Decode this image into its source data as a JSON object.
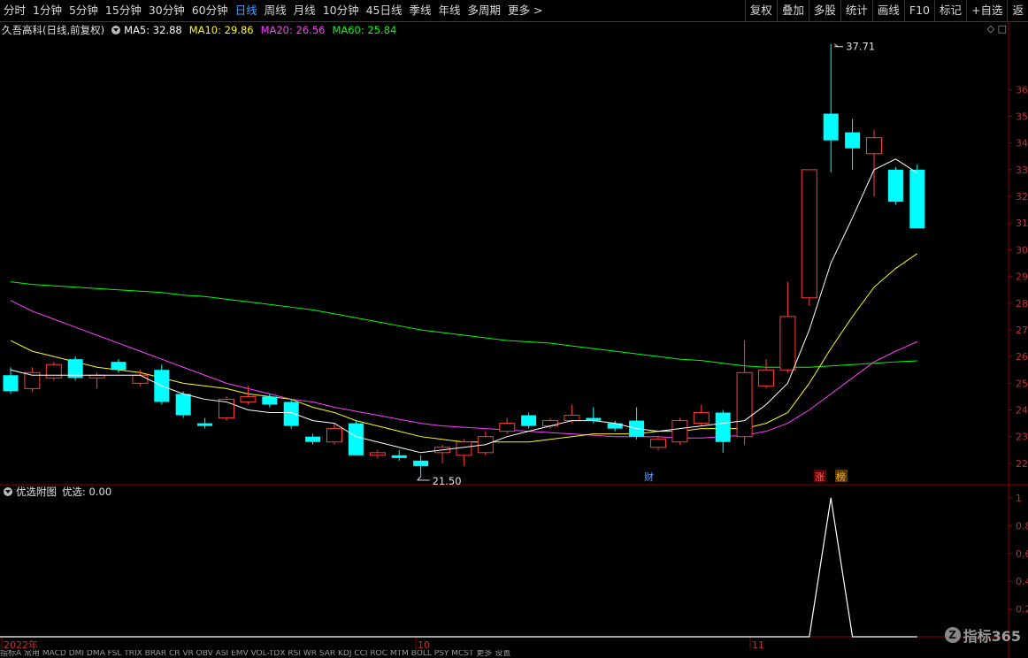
{
  "toolbar": {
    "left_items": [
      {
        "label": "分时",
        "active": false
      },
      {
        "label": "1分钟",
        "active": false
      },
      {
        "label": "5分钟",
        "active": false
      },
      {
        "label": "15分钟",
        "active": false
      },
      {
        "label": "30分钟",
        "active": false
      },
      {
        "label": "60分钟",
        "active": false
      },
      {
        "label": "日线",
        "active": true
      },
      {
        "label": "周线",
        "active": false
      },
      {
        "label": "月线",
        "active": false
      },
      {
        "label": "10分钟",
        "active": false
      },
      {
        "label": "45日线",
        "active": false
      },
      {
        "label": "季线",
        "active": false
      },
      {
        "label": "年线",
        "active": false
      },
      {
        "label": "多周期",
        "active": false
      },
      {
        "label": "更多 >",
        "active": false
      }
    ],
    "right_items": [
      "复权",
      "叠加",
      "多股",
      "统计",
      "画线",
      "F10",
      "标记",
      "+自选",
      "返"
    ]
  },
  "stock": {
    "title": "久吾高科(日线,前复权)"
  },
  "ma_legend": [
    {
      "label": "MA5: 32.88",
      "color": "#ffffff"
    },
    {
      "label": "MA10: 29.86",
      "color": "#ffff00"
    },
    {
      "label": "MA20: 26.56",
      "color": "#ff40ff"
    },
    {
      "label": "MA60: 25.84",
      "color": "#00ff00"
    }
  ],
  "subchart": {
    "title": "优选附图",
    "value_label": "优选: 0.00"
  },
  "annotations": {
    "high": "37.71",
    "low": "21.50",
    "cai": "财",
    "zhang": "涨",
    "bang": "榜"
  },
  "x_axis_labels": [
    "2022年",
    "10",
    "11"
  ],
  "price_ticks": [
    "36",
    "35",
    "34",
    "33",
    "32",
    "31",
    "30",
    "29",
    "28",
    "27",
    "26",
    "25",
    "24",
    "23",
    "22"
  ],
  "sub_ticks": [
    "1",
    "0.8",
    "0.6",
    "0.4",
    "0.2"
  ],
  "bottom_tabs": "指标A 常用 MACD DMI DMA FSL TRIX BRAR CR VR OBV ASI EMV VOL-TDX RSI WR SAR KDJ CCI ROC MTM BOLL PSY MCST 更多 设置",
  "logo": {
    "text": "指标365"
  },
  "colors": {
    "up": "#ff3c3c",
    "down": "#00ffff",
    "ma5": "#ffffff",
    "ma10": "#ffff00",
    "ma20": "#ff40ff",
    "ma60": "#00ff00",
    "axis": "#8b0000",
    "active": "#40a0ff"
  },
  "chart_data": {
    "type": "candlestick",
    "candles": [
      {
        "o": 25.3,
        "c": 24.7,
        "h": 25.6,
        "l": 24.6
      },
      {
        "o": 24.8,
        "c": 25.4,
        "h": 25.6,
        "l": 24.7
      },
      {
        "o": 25.2,
        "c": 25.7,
        "h": 25.8,
        "l": 25.1
      },
      {
        "o": 25.9,
        "c": 25.2,
        "h": 26.0,
        "l": 25.1
      },
      {
        "o": 25.2,
        "c": 25.3,
        "h": 25.4,
        "l": 24.8
      },
      {
        "o": 25.8,
        "c": 25.5,
        "h": 25.9,
        "l": 25.4
      },
      {
        "o": 25.0,
        "c": 25.3,
        "h": 25.5,
        "l": 24.9
      },
      {
        "o": 25.5,
        "c": 24.3,
        "h": 25.7,
        "l": 24.2
      },
      {
        "o": 24.6,
        "c": 23.8,
        "h": 24.7,
        "l": 23.7
      },
      {
        "o": 23.5,
        "c": 23.4,
        "h": 23.7,
        "l": 23.3
      },
      {
        "o": 23.7,
        "c": 24.4,
        "h": 24.5,
        "l": 23.6
      },
      {
        "o": 24.3,
        "c": 24.5,
        "h": 24.9,
        "l": 24.2
      },
      {
        "o": 24.5,
        "c": 24.2,
        "h": 24.6,
        "l": 24.1
      },
      {
        "o": 24.3,
        "c": 23.4,
        "h": 24.4,
        "l": 23.3
      },
      {
        "o": 23.0,
        "c": 22.8,
        "h": 23.1,
        "l": 22.7
      },
      {
        "o": 22.8,
        "c": 23.3,
        "h": 23.5,
        "l": 22.7
      },
      {
        "o": 23.5,
        "c": 22.3,
        "h": 23.6,
        "l": 22.3
      },
      {
        "o": 22.3,
        "c": 22.4,
        "h": 22.5,
        "l": 22.2
      },
      {
        "o": 22.3,
        "c": 22.2,
        "h": 22.5,
        "l": 22.1
      },
      {
        "o": 22.1,
        "c": 21.9,
        "h": 22.3,
        "l": 21.5
      },
      {
        "o": 22.4,
        "c": 22.6,
        "h": 22.7,
        "l": 22.0
      },
      {
        "o": 22.3,
        "c": 22.8,
        "h": 22.9,
        "l": 21.9
      },
      {
        "o": 22.4,
        "c": 23.0,
        "h": 23.2,
        "l": 22.3
      },
      {
        "o": 23.2,
        "c": 23.5,
        "h": 23.7,
        "l": 23.1
      },
      {
        "o": 23.8,
        "c": 23.4,
        "h": 23.9,
        "l": 23.3
      },
      {
        "o": 23.4,
        "c": 23.6,
        "h": 23.7,
        "l": 23.3
      },
      {
        "o": 23.6,
        "c": 23.8,
        "h": 24.2,
        "l": 23.5
      },
      {
        "o": 23.7,
        "c": 23.6,
        "h": 24.1,
        "l": 23.5
      },
      {
        "o": 23.5,
        "c": 23.3,
        "h": 23.6,
        "l": 23.2
      },
      {
        "o": 23.6,
        "c": 23.0,
        "h": 24.1,
        "l": 22.9
      },
      {
        "o": 22.6,
        "c": 22.9,
        "h": 23.0,
        "l": 22.5
      },
      {
        "o": 22.8,
        "c": 23.6,
        "h": 23.7,
        "l": 22.7
      },
      {
        "o": 23.5,
        "c": 23.9,
        "h": 24.2,
        "l": 23.4
      },
      {
        "o": 23.9,
        "c": 22.8,
        "h": 24.0,
        "l": 22.4
      },
      {
        "o": 23.0,
        "c": 25.4,
        "h": 26.6,
        "l": 22.7
      },
      {
        "o": 24.9,
        "c": 25.5,
        "h": 25.9,
        "l": 24.8
      },
      {
        "o": 25.5,
        "c": 27.5,
        "h": 28.8,
        "l": 25.4
      },
      {
        "o": 28.2,
        "c": 33.0,
        "h": 33.0,
        "l": 27.9
      },
      {
        "o": 35.1,
        "c": 34.1,
        "h": 37.71,
        "l": 32.9
      },
      {
        "o": 34.4,
        "c": 33.8,
        "h": 34.9,
        "l": 33.0
      },
      {
        "o": 33.6,
        "c": 34.2,
        "h": 34.5,
        "l": 32.0
      },
      {
        "o": 33.0,
        "c": 31.8,
        "h": 33.1,
        "l": 31.7
      },
      {
        "o": 33.0,
        "c": 30.8,
        "h": 33.2,
        "l": 30.8
      }
    ],
    "ma5": [
      25.5,
      25.3,
      25.3,
      25.3,
      25.3,
      25.3,
      25.3,
      24.9,
      24.6,
      24.4,
      24.3,
      24.0,
      23.9,
      23.9,
      23.6,
      23.5,
      23.0,
      22.8,
      22.6,
      22.4,
      22.5,
      22.6,
      22.7,
      23.0,
      23.2,
      23.4,
      23.6,
      23.6,
      23.5,
      23.3,
      23.2,
      23.3,
      23.4,
      23.5,
      23.6,
      24.2,
      25.0,
      27.0,
      29.5,
      31.2,
      33.0,
      33.4,
      32.88
    ],
    "ma10": [
      26.6,
      26.2,
      26.0,
      25.8,
      25.6,
      25.5,
      25.4,
      25.2,
      25.0,
      24.9,
      24.8,
      24.6,
      24.5,
      24.4,
      24.1,
      23.9,
      23.6,
      23.4,
      23.2,
      23.0,
      22.9,
      22.8,
      22.8,
      22.8,
      22.8,
      22.9,
      23.0,
      23.1,
      23.1,
      23.1,
      23.2,
      23.2,
      23.3,
      23.3,
      23.3,
      23.5,
      23.9,
      25.0,
      26.3,
      27.5,
      28.6,
      29.3,
      29.86
    ],
    "ma20": [
      28.1,
      27.7,
      27.4,
      27.1,
      26.8,
      26.5,
      26.2,
      25.9,
      25.6,
      25.3,
      25.0,
      24.8,
      24.6,
      24.4,
      24.3,
      24.1,
      23.95,
      23.8,
      23.65,
      23.5,
      23.4,
      23.35,
      23.3,
      23.25,
      23.2,
      23.15,
      23.1,
      23.05,
      23.0,
      23.0,
      23.0,
      22.95,
      22.95,
      23.0,
      23.05,
      23.2,
      23.5,
      24.0,
      24.6,
      25.2,
      25.8,
      26.2,
      26.56
    ],
    "ma60": [
      28.8,
      28.7,
      28.65,
      28.6,
      28.55,
      28.5,
      28.45,
      28.4,
      28.3,
      28.25,
      28.15,
      28.05,
      27.95,
      27.85,
      27.75,
      27.6,
      27.45,
      27.3,
      27.15,
      27.0,
      26.9,
      26.8,
      26.7,
      26.6,
      26.55,
      26.5,
      26.4,
      26.3,
      26.2,
      26.1,
      26.0,
      25.9,
      25.85,
      25.75,
      25.65,
      25.6,
      25.6,
      25.6,
      25.65,
      25.7,
      25.75,
      25.8,
      25.84
    ],
    "sub_values": [
      0,
      0,
      0,
      0,
      0,
      0,
      0,
      0,
      0,
      0,
      0,
      0,
      0,
      0,
      0,
      0,
      0,
      0,
      0,
      0,
      0,
      0,
      0,
      0,
      0,
      0,
      0,
      0,
      0,
      0,
      0,
      0,
      0,
      0,
      0,
      0,
      0,
      0,
      1,
      0,
      0,
      0,
      0
    ],
    "price_range": [
      21.3,
      37.9
    ],
    "sub_range": [
      0,
      1
    ]
  }
}
